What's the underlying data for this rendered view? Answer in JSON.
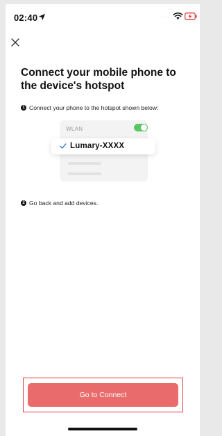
{
  "status_bar": {
    "time": "02:40",
    "signal": "....",
    "icons": [
      "location-arrow-icon",
      "wifi-icon",
      "battery-charging-icon"
    ],
    "battery_color": "#e33b3b"
  },
  "header": {
    "close_icon": "close-icon"
  },
  "title": "Connect your mobile phone to the device's hotspot",
  "steps": [
    {
      "number": "1",
      "text": "Connect your phone to the hotspot shown below:"
    },
    {
      "number": "2",
      "text": "Go back and add devices."
    }
  ],
  "illustration": {
    "wlan_label": "WLAN",
    "wlan_toggle_on": true,
    "network_name": "Lumary-XXXX",
    "check_icon": "check-icon",
    "toggle_color": "#5cc565",
    "check_color": "#3a7de0"
  },
  "cta": {
    "label": "Go to Connect",
    "color": "#e96b6b",
    "highlight_color": "#e03a3a"
  }
}
